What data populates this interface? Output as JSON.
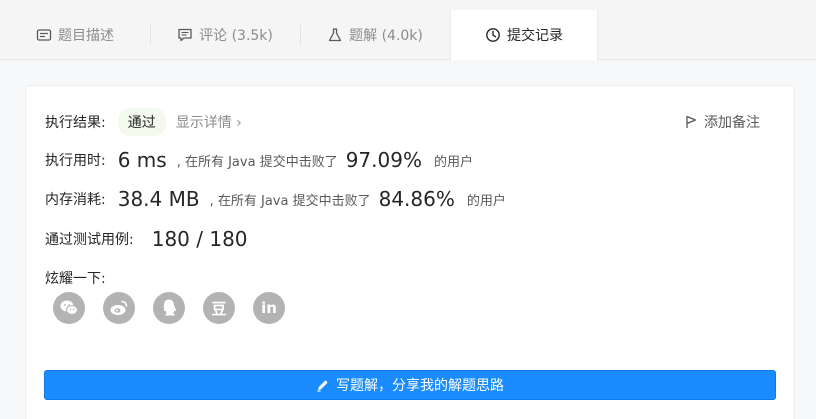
{
  "tabs": [
    {
      "label": "题目描述",
      "icon": "description-icon"
    },
    {
      "label": "评论 (3.5k)",
      "icon": "comment-icon"
    },
    {
      "label": "题解 (4.0k)",
      "icon": "flask-icon"
    },
    {
      "label": "提交记录",
      "icon": "clock-icon",
      "active": true
    }
  ],
  "result": {
    "label": "执行结果:",
    "status": "通过",
    "detail_link": "显示详情 ›",
    "add_note": "添加备注"
  },
  "runtime": {
    "label": "执行用时:",
    "value": "6 ms",
    "mid_text": ", 在所有 Java 提交中击败了",
    "percent": "97.09%",
    "suffix": "的用户"
  },
  "memory": {
    "label": "内存消耗:",
    "value": "38.4 MB",
    "mid_text": ", 在所有 Java 提交中击败了",
    "percent": "84.86%",
    "suffix": "的用户"
  },
  "tests": {
    "label": "通过测试用例:",
    "value": "180 / 180"
  },
  "share": {
    "label": "炫耀一下:",
    "icons": [
      "wechat-icon",
      "weibo-icon",
      "qq-icon",
      "douban-icon",
      "linkedin-icon"
    ],
    "douban_glyph": "豆",
    "linkedin_glyph": "in"
  },
  "write_button": "写题解，分享我的解题思路",
  "colors": {
    "primary": "#1a8cff",
    "badge_bg": "#f3f9ec",
    "icon_grey": "#b3b3b3"
  }
}
